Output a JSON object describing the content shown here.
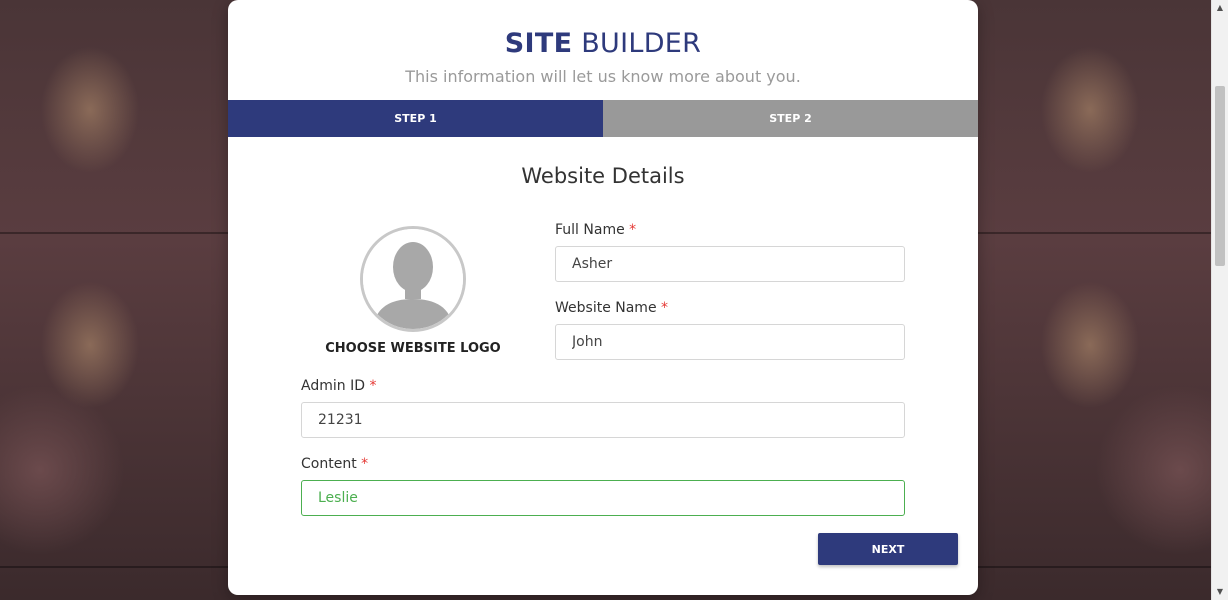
{
  "header": {
    "title_bold": "SITE",
    "title_light": "BUILDER",
    "subtitle": "This information will let us know more about you."
  },
  "steps": [
    {
      "label": "STEP 1",
      "active": true
    },
    {
      "label": "STEP 2",
      "active": false
    }
  ],
  "section_title": "Website Details",
  "logo": {
    "label": "CHOOSE WEBSITE LOGO"
  },
  "fields": {
    "full_name": {
      "label": "Full Name",
      "required_mark": "*",
      "value": "Asher"
    },
    "website_name": {
      "label": "Website Name",
      "required_mark": "*",
      "value": "John"
    },
    "admin_id": {
      "label": "Admin ID",
      "required_mark": "*",
      "value": "21231"
    },
    "content": {
      "label": "Content",
      "required_mark": "*",
      "value": "Leslie"
    }
  },
  "buttons": {
    "next_label": "NEXT"
  },
  "colors": {
    "primary": "#2e3a7c",
    "inactive_step": "#999999",
    "required": "#e53935",
    "focus": "#4caf50"
  }
}
